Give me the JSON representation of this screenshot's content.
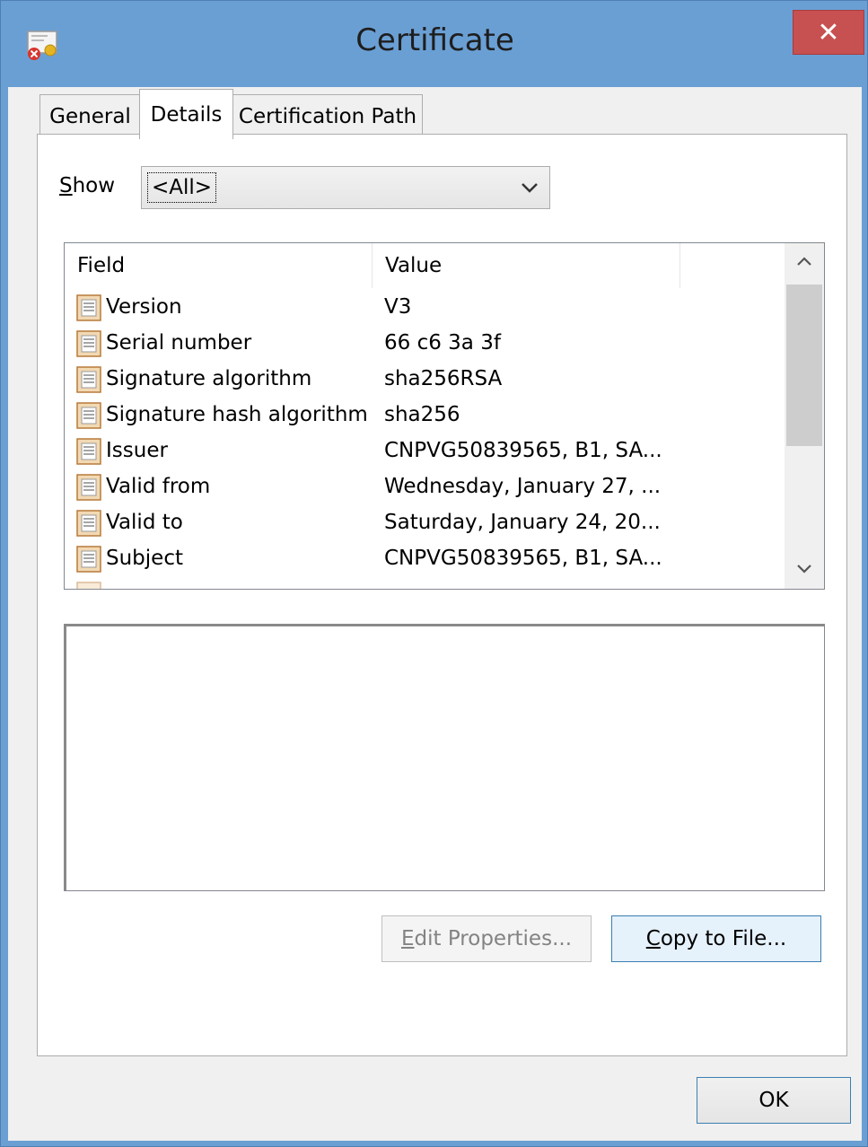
{
  "window": {
    "title": "Certificate",
    "close_glyph": "✕"
  },
  "tabs": [
    {
      "label": "General",
      "active": false
    },
    {
      "label": "Details",
      "active": true
    },
    {
      "label": "Certification Path",
      "active": false
    }
  ],
  "show": {
    "label_accel": "S",
    "label_rest": "how",
    "selected": "<All>"
  },
  "fields_list": {
    "columns": [
      "Field",
      "Value"
    ],
    "rows": [
      {
        "field": "Version",
        "value": "V3"
      },
      {
        "field": "Serial number",
        "value": "66 c6 3a 3f"
      },
      {
        "field": "Signature algorithm",
        "value": "sha256RSA"
      },
      {
        "field": "Signature hash algorithm",
        "value": "sha256"
      },
      {
        "field": "Issuer",
        "value": "CNPVG50839565, B1, SA..."
      },
      {
        "field": "Valid from",
        "value": "Wednesday, January 27, ..."
      },
      {
        "field": "Valid to",
        "value": "Saturday, January 24, 20..."
      },
      {
        "field": "Subject",
        "value": "CNPVG50839565, B1, SA..."
      }
    ]
  },
  "buttons": {
    "edit_properties_accel": "E",
    "edit_properties_rest": "dit Properties...",
    "copy_to_file_accel": "C",
    "copy_to_file_rest": "opy to File...",
    "ok": "OK"
  },
  "colors": {
    "title_bar": "#6a9fd4",
    "close_button": "#c75050",
    "client_background": "#f0f0f0"
  }
}
